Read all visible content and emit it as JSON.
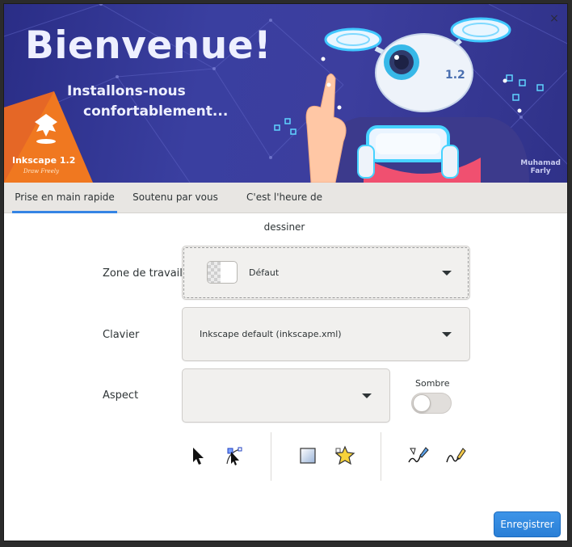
{
  "banner": {
    "title": "Bienvenue!",
    "subtitle_line1": "Installons-nous",
    "subtitle_line2": "confortablement...",
    "version_badge": "1.2",
    "logo_name": "Inkscape 1.2",
    "logo_tagline": "Draw Freely",
    "artist_line1": "Muhamad",
    "artist_line2": "Farly",
    "close_symbol": "×"
  },
  "tabs": [
    {
      "label": "Prise en main rapide",
      "active": true
    },
    {
      "label": "Soutenu par vous",
      "active": false
    },
    {
      "label": "C'est l'heure de dessiner",
      "active": false
    }
  ],
  "settings": {
    "workspace": {
      "label": "Zone de travail",
      "value": "Défaut"
    },
    "keyboard": {
      "label": "Clavier",
      "value": "Inkscape default (inkscape.xml)"
    },
    "appearance": {
      "label": "Aspect",
      "value": ""
    },
    "dark": {
      "label": "Sombre",
      "on": false
    }
  },
  "tools": [
    {
      "icon": "selector-arrow-icon"
    },
    {
      "icon": "node-editor-icon"
    },
    {
      "icon": "rectangle-tool-icon"
    },
    {
      "icon": "star-tool-icon"
    },
    {
      "icon": "pen-tool-icon"
    },
    {
      "icon": "pencil-tool-icon"
    }
  ],
  "footer": {
    "save_label": "Enregistrer"
  },
  "colors": {
    "accent": "#3584e4",
    "banner_bg": "#3a3fa0",
    "logo_orange": "#f07820"
  }
}
